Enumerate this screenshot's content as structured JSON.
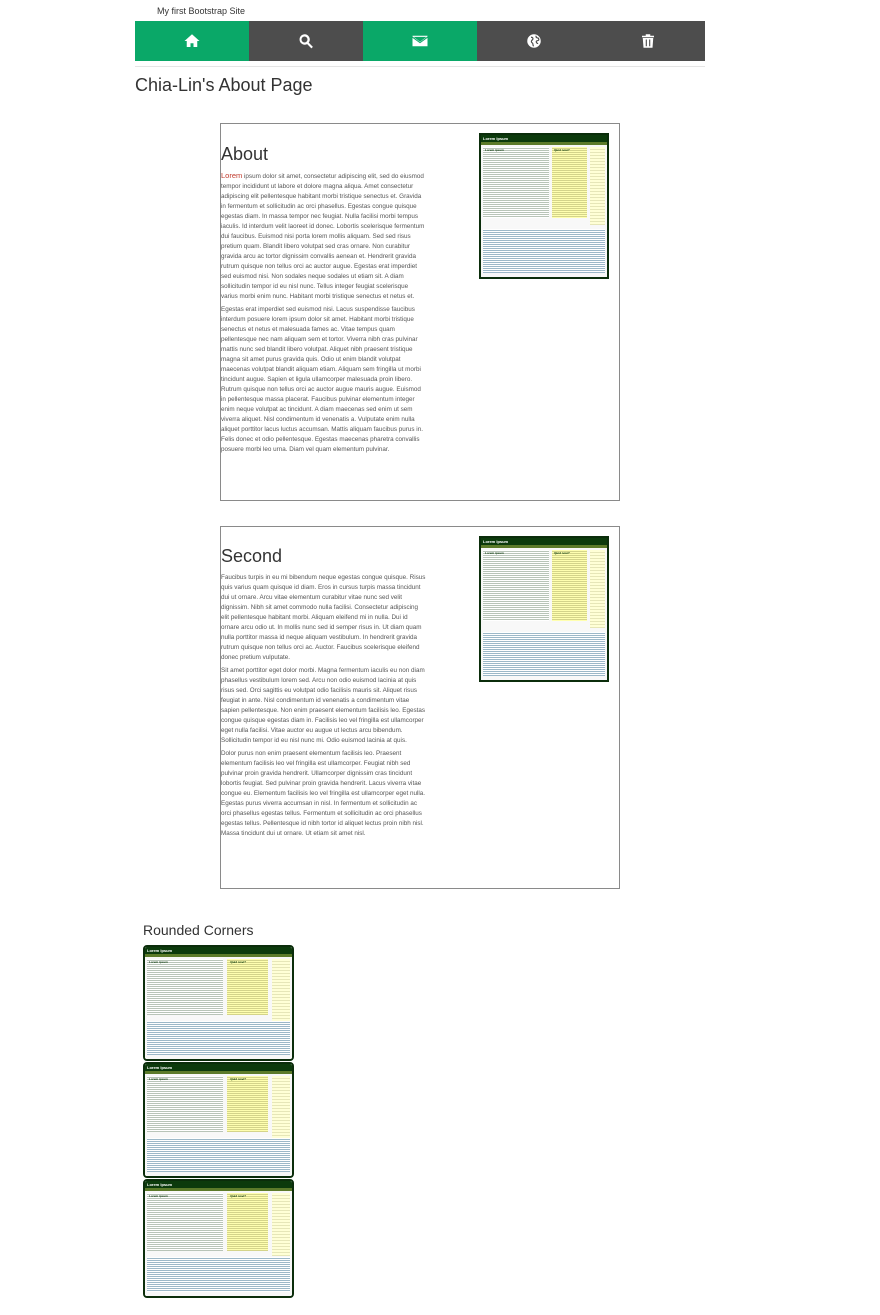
{
  "brand": "My first Bootstrap Site",
  "nav": {
    "items": [
      {
        "icon": "home-icon",
        "active": true
      },
      {
        "icon": "search-icon",
        "active": false
      },
      {
        "icon": "envelope-icon",
        "active": true
      },
      {
        "icon": "globe-icon",
        "active": false
      },
      {
        "icon": "trash-icon",
        "active": false
      }
    ]
  },
  "colors": {
    "nav_active": "#0aa868",
    "nav_default": "#4d4d4d",
    "thumb_border": "#0b2d0b"
  },
  "page_title": "Chia-Lin's About Page",
  "about": {
    "heading": "About",
    "lead_word": "Lorem",
    "p1": " ipsum dolor sit amet, consectetur adipiscing elit, sed do eiusmod tempor incididunt ut labore et dolore magna aliqua. Amet consectetur adipiscing elit pellentesque habitant morbi tristique senectus et. Gravida in fermentum et sollicitudin ac orci phasellus. Egestas congue quisque egestas diam. In massa tempor nec feugiat. Nulla facilisi morbi tempus iaculis. Id interdum velit laoreet id donec. Lobortis scelerisque fermentum dui faucibus. Euismod nisi porta lorem mollis aliquam. Sed sed risus pretium quam. Blandit libero volutpat sed cras ornare. Non curabitur gravida arcu ac tortor dignissim convallis aenean et. Hendrerit gravida rutrum quisque non tellus orci ac auctor augue. Egestas erat imperdiet sed euismod nisi. Non sodales neque sodales ut etiam sit. A diam sollicitudin tempor id eu nisl nunc. Tellus integer feugiat scelerisque varius morbi enim nunc. Habitant morbi tristique senectus et netus et.",
    "p2": "Egestas erat imperdiet sed euismod nisi. Lacus suspendisse faucibus interdum posuere lorem ipsum dolor sit amet. Habitant morbi tristique senectus et netus et malesuada fames ac. Vitae tempus quam pellentesque nec nam aliquam sem et tortor. Viverra nibh cras pulvinar mattis nunc sed blandit libero volutpat. Aliquet nibh praesent tristique magna sit amet purus gravida quis. Odio ut enim blandit volutpat maecenas volutpat blandit aliquam etiam. Aliquam sem fringilla ut morbi tincidunt augue. Sapien et ligula ullamcorper malesuada proin libero. Rutrum quisque non tellus orci ac auctor augue mauris augue. Euismod in pellentesque massa placerat. Faucibus pulvinar elementum integer enim neque volutpat ac tincidunt. A diam maecenas sed enim ut sem viverra aliquet. Nisl condimentum id venenatis a. Vulputate enim nulla aliquet porttitor lacus luctus accumsan. Mattis aliquam faucibus purus in. Felis donec et odio pellentesque. Egestas maecenas pharetra convallis posuere morbi leo urna. Diam vel quam elementum pulvinar."
  },
  "second": {
    "heading": "Second",
    "p1": "Faucibus turpis in eu mi bibendum neque egestas congue quisque. Risus quis varius quam quisque id diam. Eros in cursus turpis massa tincidunt dui ut ornare. Arcu vitae elementum curabitur vitae nunc sed velit dignissim. Nibh sit amet commodo nulla facilisi. Consectetur adipiscing elit pellentesque habitant morbi. Aliquam eleifend mi in nulla. Dui id ornare arcu odio ut. In mollis nunc sed id semper risus in. Ut diam quam nulla porttitor massa id neque aliquam vestibulum. In hendrerit gravida rutrum quisque non tellus orci ac. Auctor. Faucibus scelerisque eleifend donec pretium vulputate.",
    "p2": "Sit amet porttitor eget dolor morbi. Magna fermentum iaculis eu non diam phasellus vestibulum lorem sed. Arcu non odio euismod lacinia at quis risus sed. Orci sagittis eu volutpat odio facilisis mauris sit. Aliquet risus feugiat in ante. Nisl condimentum id venenatis a condimentum vitae sapien pellentesque. Non enim praesent elementum facilisis leo. Egestas congue quisque egestas diam in. Facilisis leo vel fringilla est ullamcorper eget nulla facilisi. Vitae auctor eu augue ut lectus arcu bibendum. Sollicitudin tempor id eu nisl nunc mi. Odio euismod lacinia at quis.",
    "p3": "Dolor purus non enim praesent elementum facilisis leo. Praesent elementum facilisis leo vel fringilla est ullamcorper. Feugiat nibh sed pulvinar proin gravida hendrerit. Ullamcorper dignissim cras tincidunt lobortis feugiat. Sed pulvinar proin gravida hendrerit. Lacus viverra vitae congue eu. Elementum facilisis leo vel fringilla est ullamcorper eget nulla. Egestas purus viverra accumsan in nisl. In fermentum et sollicitudin ac orci phasellus egestas tellus. Fermentum et sollicitudin ac orci phasellus egestas tellus. Pellentesque id nibh tortor id aliquet lectus proin nibh nisl. Massa tincidunt dui ut ornare. Ut etiam sit amet nisl."
  },
  "thumbnail": {
    "site_title": "Lorem Ipsum",
    "col1": "Lorem ipsum",
    "col2": "Quid novi?"
  },
  "rounded_corners": {
    "title": "Rounded Corners"
  }
}
